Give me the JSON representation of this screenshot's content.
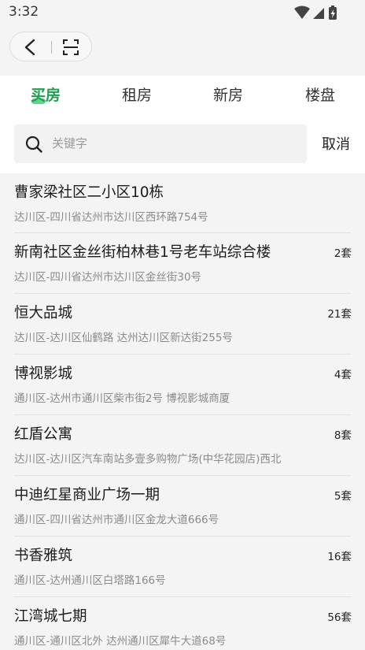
{
  "status_bar": {
    "time": "3:32"
  },
  "tabs": [
    {
      "label": "买房",
      "active": true
    },
    {
      "label": "租房",
      "active": false
    },
    {
      "label": "新房",
      "active": false
    },
    {
      "label": "楼盘",
      "active": false
    }
  ],
  "search": {
    "placeholder": "关键字",
    "value": "",
    "cancel_label": "取消"
  },
  "results": [
    {
      "name": "曹家梁社区二小区10栋",
      "address": "达川区-四川省达州市达川区西环路754号",
      "count": ""
    },
    {
      "name": "新南社区金丝街柏林巷1号老车站综合楼",
      "address": "达川区-四川省达州市达川区金丝街30号",
      "count": "2套"
    },
    {
      "name": "恒大品城",
      "address": "达川区-达川区仙鹤路 达州达川区新达街255号",
      "count": "21套"
    },
    {
      "name": "博视影城",
      "address": "通川区-达州市通川区柴市街2号 博视影城商厦",
      "count": "4套"
    },
    {
      "name": "红盾公寓",
      "address": "达川区-达川区汽车南站多壹多购物广场(中华花园店)西北",
      "count": "8套"
    },
    {
      "name": "中迪红星商业广场一期",
      "address": "通川区-四川省达州市通川区金龙大道666号",
      "count": "5套"
    },
    {
      "name": "书香雅筑",
      "address": "通川区-达州通川区白塔路166号",
      "count": "16套"
    },
    {
      "name": "江湾城七期",
      "address": "通川区-通川区北外 达州通川区犀牛大道68号",
      "count": "56套"
    }
  ],
  "colors": {
    "accent": "#1ca24f",
    "accent_underline": "#5fd38c"
  },
  "icons": {
    "back": "back-arrow-icon",
    "scan": "scan-icon",
    "search": "search-icon"
  }
}
